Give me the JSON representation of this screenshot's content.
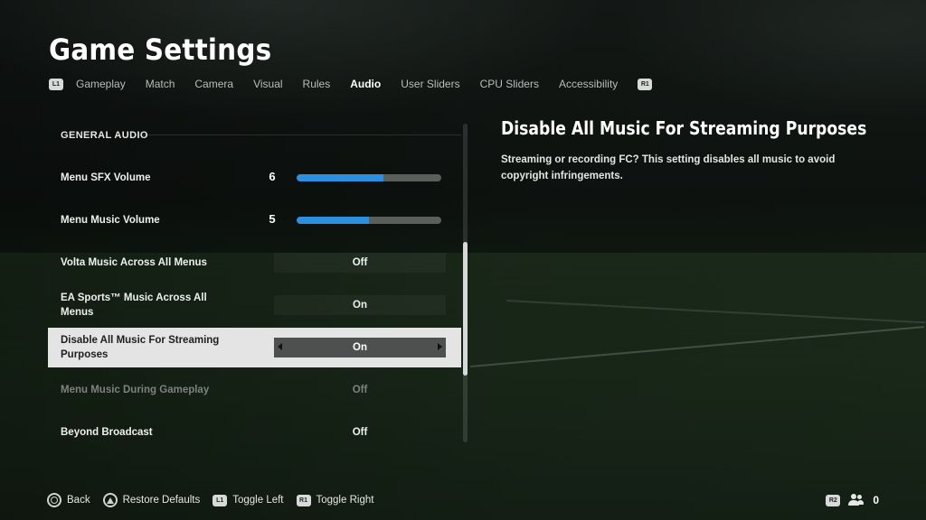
{
  "page": {
    "title": "Game Settings"
  },
  "tabs": {
    "left_button": "L1",
    "right_button": "R1",
    "items": [
      "Gameplay",
      "Match",
      "Camera",
      "Visual",
      "Rules",
      "Audio",
      "User Sliders",
      "CPU Sliders",
      "Accessibility"
    ],
    "active": "Audio"
  },
  "settings": {
    "section": "GENERAL AUDIO",
    "rows": [
      {
        "label": "Menu SFX Volume",
        "type": "slider",
        "value": "6",
        "fraction": 0.6
      },
      {
        "label": "Menu Music Volume",
        "type": "slider",
        "value": "5",
        "fraction": 0.5
      },
      {
        "label": "Volta Music Across All Menus",
        "type": "toggle",
        "value": "Off"
      },
      {
        "label": "EA Sports™ Music Across All Menus",
        "type": "toggle",
        "value": "On"
      },
      {
        "label": "Disable All Music For Streaming Purposes",
        "type": "toggle",
        "value": "On",
        "selected": true
      },
      {
        "label": "Menu Music During Gameplay",
        "type": "toggle",
        "value": "Off",
        "disabled": true
      },
      {
        "label": "Beyond Broadcast",
        "type": "toggle",
        "value": "Off"
      }
    ]
  },
  "description": {
    "title": "Disable All Music For Streaming Purposes",
    "body": "Streaming or recording FC? This setting disables all music to avoid copyright infringements."
  },
  "footer": {
    "back": "Back",
    "restore": "Restore Defaults",
    "toggle_left_button": "L1",
    "toggle_left": "Toggle Left",
    "toggle_right_button": "R1",
    "toggle_right": "Toggle Right",
    "r2_button": "R2",
    "party_count": "0"
  },
  "colors": {
    "accent": "#2d8fe0",
    "selected_row": "#e3e4e3"
  },
  "icons": {
    "back": "circle-button-icon",
    "restore": "triangle-button-icon",
    "party": "people-icon"
  }
}
